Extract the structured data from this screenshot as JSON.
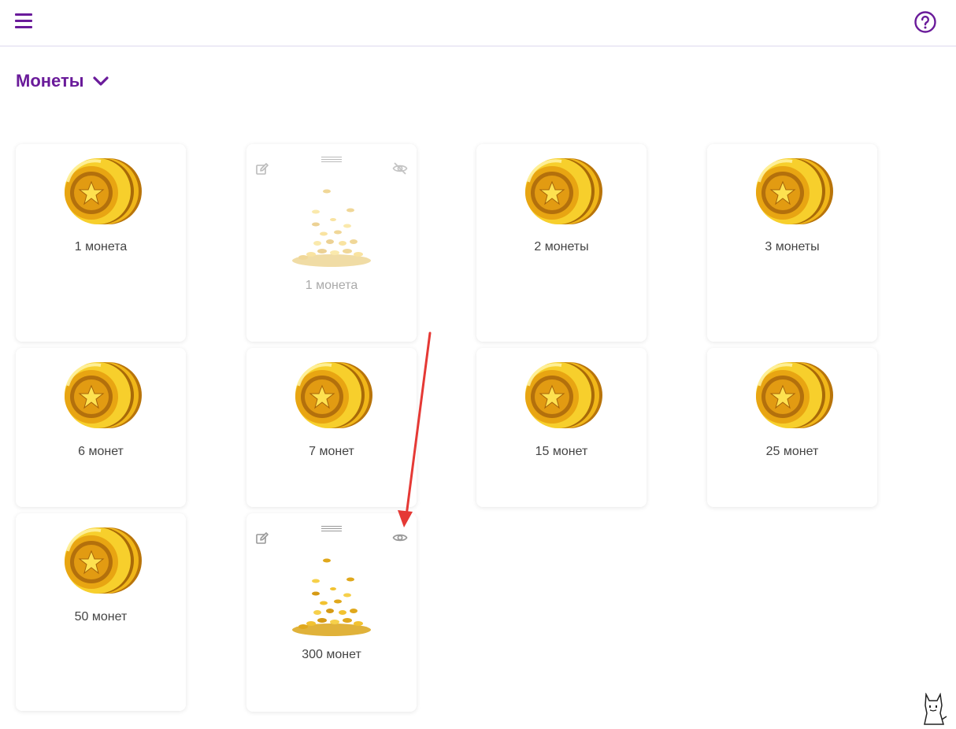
{
  "header": {
    "menu_icon": "hamburger-icon",
    "help_icon": "question-circle-icon"
  },
  "section": {
    "title": "Монеты",
    "toggle_icon": "chevron-down-icon"
  },
  "cards": [
    {
      "label": "1 монета",
      "image": "coin-stack-icon"
    },
    {
      "label": "1 монета",
      "image": "coin-pile-icon",
      "admin": true,
      "hidden": true,
      "visibility_icon": "eye-off-icon"
    },
    {
      "label": "2 монеты",
      "image": "coin-stack-icon"
    },
    {
      "label": "3 монеты",
      "image": "coin-stack-icon"
    },
    {
      "label": "6 монет",
      "image": "coin-stack-icon"
    },
    {
      "label": "7 монет",
      "image": "coin-stack-icon"
    },
    {
      "label": "15 монет",
      "image": "coin-stack-icon"
    },
    {
      "label": "25 монет",
      "image": "coin-stack-icon"
    },
    {
      "label": "50 монет",
      "image": "coin-stack-icon"
    },
    {
      "label": "300 монет",
      "image": "coin-pile-icon",
      "admin": true,
      "hidden": false,
      "visibility_icon": "eye-icon"
    }
  ],
  "annotation": {
    "arrow_color": "#e53935"
  },
  "colors": {
    "accent": "#6a1b9a",
    "coin_gold": "#f5c518",
    "coin_dark": "#c98a0e"
  }
}
